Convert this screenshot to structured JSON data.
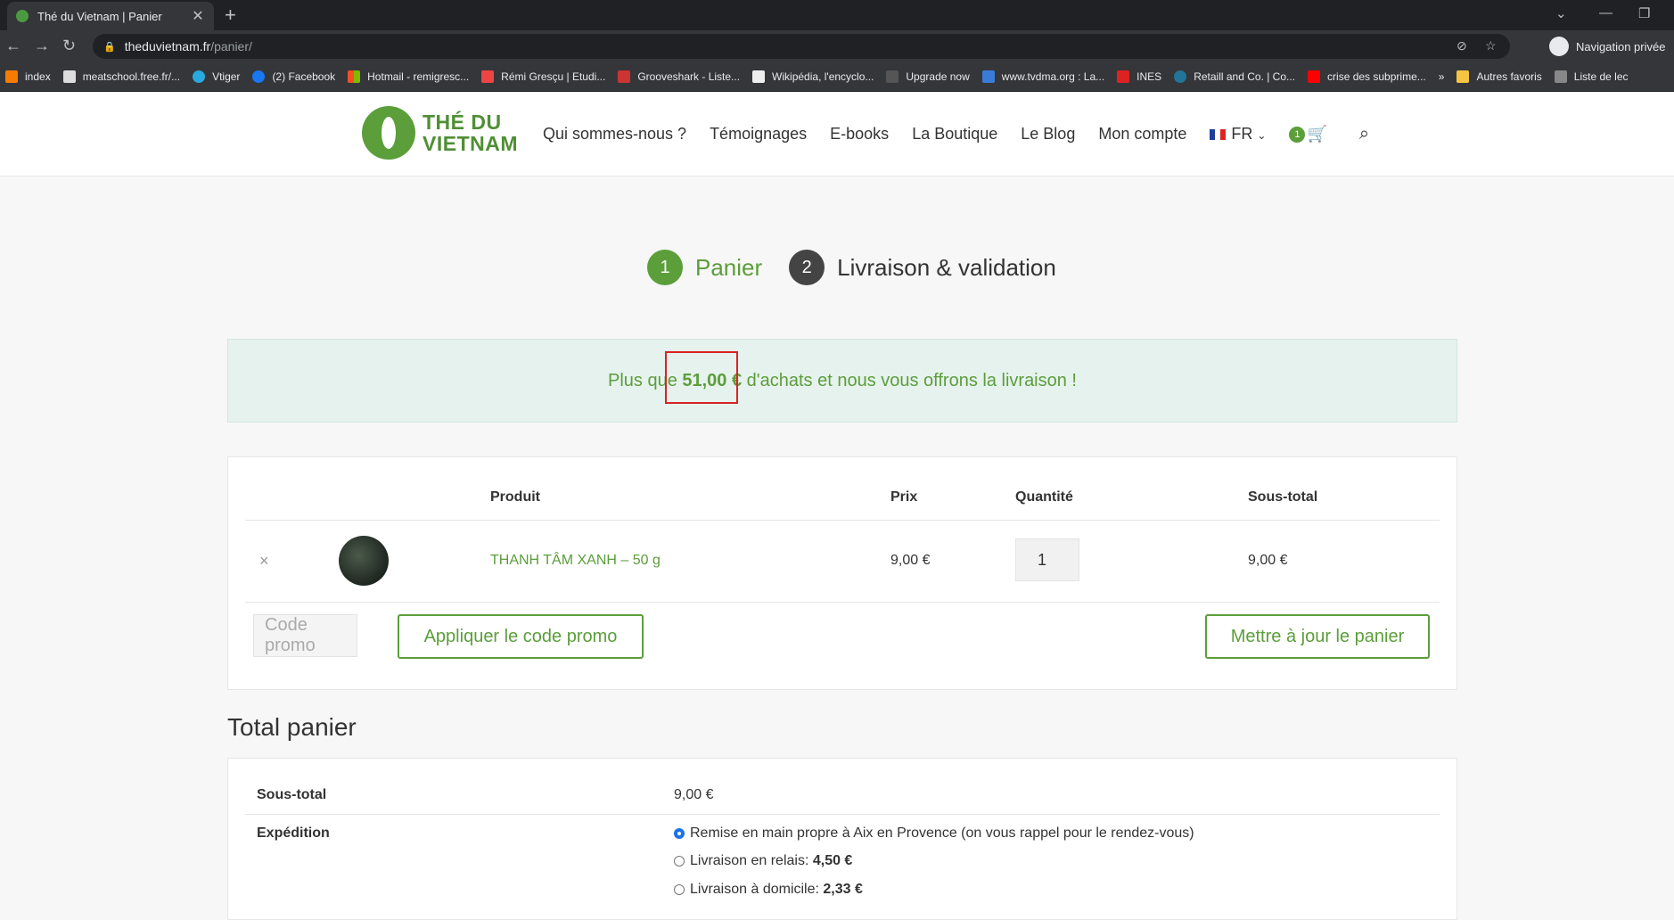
{
  "browser": {
    "tab_title": "Thé du Vietnam | Panier",
    "url_host": "theduvietnam.fr",
    "url_path": "/panier/",
    "private_label": "Navigation privée",
    "bookmarks": [
      "index",
      "meatschool.free.fr/...",
      "Vtiger",
      "(2) Facebook",
      "Hotmail - remigresc...",
      "Rémi Gresçu | Etudi...",
      "Grooveshark - Liste...",
      "Wikipédia, l'encyclo...",
      "Upgrade now",
      "www.tvdma.org : La...",
      "INES",
      "Retaill and Co. | Co...",
      "crise des subprime..."
    ],
    "bookmarks_more": "»",
    "other_bookmarks": "Autres favoris",
    "reading_list": "Liste de lec"
  },
  "site": {
    "logo_line1": "THÉ DU",
    "logo_line2": "VIETNAM",
    "nav": [
      "Qui sommes-nous ?",
      "Témoignages",
      "E-books",
      "La Boutique",
      "Le Blog",
      "Mon compte"
    ],
    "lang": "FR",
    "cart_count": "1"
  },
  "steps": {
    "s1_num": "1",
    "s1_label": "Panier",
    "s2_num": "2",
    "s2_label": "Livraison & validation"
  },
  "notice": {
    "before": "Plus que ",
    "amount": "51,00 €",
    "after": " d'achats et nous vous offrons la livraison !"
  },
  "cart": {
    "headers": {
      "product": "Produit",
      "price": "Prix",
      "quantity": "Quantité",
      "subtotal": "Sous-total"
    },
    "remove": "×",
    "item": {
      "name": "THANH TÂM XANH – 50 g",
      "price": "9,00 €",
      "qty": "1",
      "subtotal": "9,00 €"
    },
    "promo_placeholder": "Code promo",
    "apply_label": "Appliquer le code promo",
    "update_label": "Mettre à jour le panier"
  },
  "totals": {
    "title": "Total panier",
    "subtotal_label": "Sous-total",
    "subtotal_value": "9,00 €",
    "shipping_label": "Expédition",
    "options": [
      {
        "label": "Remise en main propre à Aix en Provence (on vous rappel pour le rendez-vous)",
        "price": "",
        "selected": true
      },
      {
        "label": "Livraison en relais: ",
        "price": "4,50 €",
        "selected": false
      },
      {
        "label": "Livraison à domicile: ",
        "price": "2,33 €",
        "selected": false
      }
    ]
  },
  "colors": {
    "brand_green": "#5b9e3a",
    "notice_bg": "#e6f2ee",
    "highlight_red": "#d92222"
  }
}
